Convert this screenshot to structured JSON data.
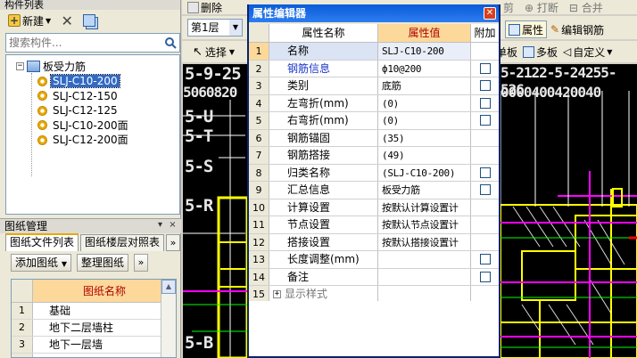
{
  "left_panel": {
    "title": "构件列表",
    "new_label": "新建",
    "search_placeholder": "搜索构件...",
    "tree_root": "板受力筋",
    "tree_items": [
      "SLJ-C10-200",
      "SLJ-C12-150",
      "SLJ-C12-125",
      "SLJ-C10-200面",
      "SLJ-C12-200面"
    ],
    "drawings_title": "图纸管理",
    "tabs": [
      "图纸文件列表",
      "图纸楼层对照表"
    ],
    "tab_more": "»",
    "add_drawing": "添加图纸",
    "arrange_drawing": "整理图纸",
    "table_header": "图纸名称",
    "rows": [
      {
        "n": "1",
        "name": "基础"
      },
      {
        "n": "2",
        "name": "地下二层墙柱"
      },
      {
        "n": "3",
        "name": "地下一层墙"
      },
      {
        "n": "4",
        "name": ""
      }
    ]
  },
  "toolbar": {
    "delete_label": "删除",
    "floor_value": "第1层",
    "select_label": "选择",
    "print_label": "打断",
    "merge_label": "合并",
    "cut_label": "剪",
    "property_label": "属性",
    "edit_rebar_label": "编辑钢筋",
    "single_board": "单板",
    "multi_board": "多板",
    "custom": "自定义"
  },
  "cad": {
    "axis_top": "5-9-25",
    "axis_top2": "5060820",
    "axis_labels": [
      "5-U",
      "5-T",
      "5-S",
      "5-R",
      "5-B"
    ],
    "axis_right_top": "5-2122-5-24255-526",
    "axis_right_top2": "0000400420040"
  },
  "dialog": {
    "title": "属性编辑器",
    "col_name": "属性名称",
    "col_value": "属性值",
    "col_attach": "附加",
    "rows": [
      {
        "n": "1",
        "name": "名称",
        "value": "SLJ-C10-200",
        "chk": false,
        "blue": false
      },
      {
        "n": "2",
        "name": "钢筋信息",
        "value": "ф10@200",
        "chk": true,
        "blue": true
      },
      {
        "n": "3",
        "name": "类别",
        "value": "底筋",
        "chk": true,
        "blue": false
      },
      {
        "n": "4",
        "name": "左弯折(mm)",
        "value": "(0)",
        "chk": true,
        "blue": false
      },
      {
        "n": "5",
        "name": "右弯折(mm)",
        "value": "(0)",
        "chk": true,
        "blue": false
      },
      {
        "n": "6",
        "name": "钢筋锚固",
        "value": "(35)",
        "chk": false,
        "blue": false
      },
      {
        "n": "7",
        "name": "钢筋搭接",
        "value": "(49)",
        "chk": false,
        "blue": false
      },
      {
        "n": "8",
        "name": "归类名称",
        "value": "(SLJ-C10-200)",
        "chk": true,
        "blue": false
      },
      {
        "n": "9",
        "name": "汇总信息",
        "value": "板受力筋",
        "chk": true,
        "blue": false
      },
      {
        "n": "10",
        "name": "计算设置",
        "value": "按默认计算设置计",
        "chk": false,
        "blue": false
      },
      {
        "n": "11",
        "name": "节点设置",
        "value": "按默认节点设置计",
        "chk": false,
        "blue": false
      },
      {
        "n": "12",
        "name": "搭接设置",
        "value": "按默认搭接设置计",
        "chk": false,
        "blue": false
      },
      {
        "n": "13",
        "name": "长度调整(mm)",
        "value": "",
        "chk": true,
        "blue": false
      },
      {
        "n": "14",
        "name": "备注",
        "value": "",
        "chk": true,
        "blue": false
      }
    ],
    "group_row": {
      "n": "15",
      "name": "显示样式"
    }
  }
}
